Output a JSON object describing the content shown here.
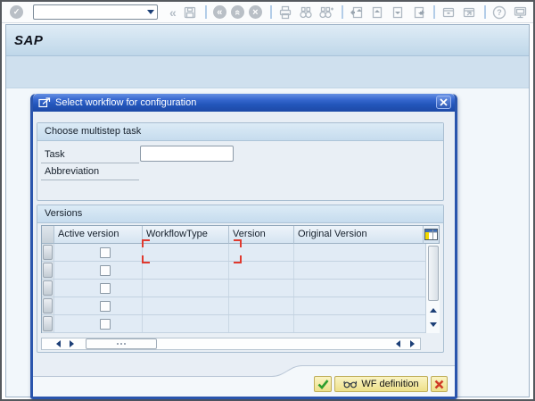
{
  "header": {
    "app_title": "SAP"
  },
  "toolbar": {
    "command_field": {
      "value": "",
      "placeholder": ""
    },
    "icons": [
      "enter-icon",
      "chevron-down-icon",
      "back-chevrons-icon",
      "save-icon",
      "back-circle-icon",
      "exit-circle-icon",
      "cancel-circle-icon",
      "print-icon",
      "find-icon",
      "find-next-icon",
      "first-page-icon",
      "previous-page-icon",
      "next-page-icon",
      "last-page-icon",
      "new-session-icon",
      "create-shortcut-icon",
      "help-icon",
      "customize-layout-icon"
    ],
    "glyphs": {
      "back_chevrons": "«",
      "circle_back": "«",
      "circle_up": "«",
      "circle_cancel": "×",
      "help": "?"
    }
  },
  "dialog": {
    "title": "Select workflow for configuration",
    "task_group": {
      "title": "Choose multistep task",
      "task_label": "Task",
      "task_value": "",
      "abbreviation_label": "Abbreviation",
      "abbreviation_value": ""
    },
    "versions_group": {
      "title": "Versions",
      "table": {
        "columns": [
          "Active version",
          "WorkflowType",
          "Version",
          "Original Version"
        ],
        "rows": [
          {
            "active_version": false,
            "workflow_type": "",
            "version": "",
            "original_version": ""
          },
          {
            "active_version": false,
            "workflow_type": "",
            "version": "",
            "original_version": ""
          },
          {
            "active_version": false,
            "workflow_type": "",
            "version": "",
            "original_version": ""
          },
          {
            "active_version": false,
            "workflow_type": "",
            "version": "",
            "original_version": ""
          },
          {
            "active_version": false,
            "workflow_type": "",
            "version": "",
            "original_version": ""
          }
        ]
      }
    },
    "footer": {
      "wf_definition_label": "WF definition"
    }
  },
  "colors": {
    "title_bar_blue": "#2356bb",
    "dialog_border_blue": "#2a55ad",
    "dialog_bg": "#e8eef5",
    "row_bg": "#e1ebf5",
    "button_yellow": "#f3e9a9",
    "confirm_green": "#2f9e2f",
    "cancel_red": "#cf3a26",
    "focus_red": "#e0392e",
    "config_icon_yellow": "#f2d800"
  }
}
